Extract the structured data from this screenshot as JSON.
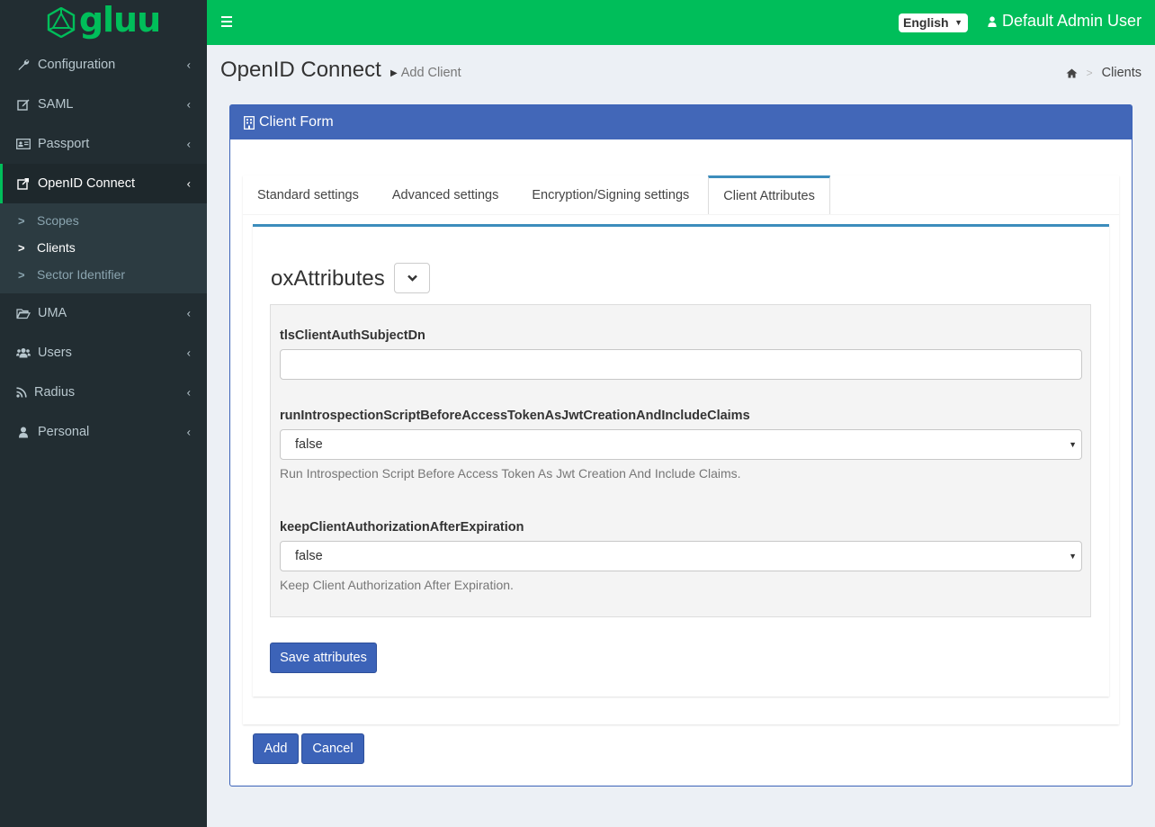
{
  "logo": {
    "text": "gluu"
  },
  "sidebar": {
    "items": [
      {
        "label": "Configuration",
        "icon": "wrench-icon"
      },
      {
        "label": "SAML",
        "icon": "edit-icon"
      },
      {
        "label": "Passport",
        "icon": "id-card-icon"
      },
      {
        "label": "OpenID Connect",
        "icon": "external-link-icon"
      },
      {
        "label": "UMA",
        "icon": "folder-open-icon"
      },
      {
        "label": "Users",
        "icon": "users-icon"
      },
      {
        "label": "Radius",
        "icon": "rss-icon"
      },
      {
        "label": "Personal",
        "icon": "user-icon"
      }
    ],
    "subitems": [
      {
        "label": "Scopes"
      },
      {
        "label": "Clients"
      },
      {
        "label": "Sector Identifier"
      }
    ]
  },
  "header": {
    "language": "English",
    "user": "Default Admin User"
  },
  "page": {
    "title": "OpenID Connect",
    "subtitle": "Add Client",
    "breadcrumb": "Clients"
  },
  "form": {
    "title": "Client Form",
    "tabs": [
      {
        "label": "Standard settings"
      },
      {
        "label": "Advanced settings"
      },
      {
        "label": "Encryption/Signing settings"
      },
      {
        "label": "Client Attributes"
      }
    ],
    "section_title": "oxAttributes",
    "fields": [
      {
        "label": "tlsClientAuthSubjectDn",
        "value": ""
      },
      {
        "label": "runIntrospectionScriptBeforeAccessTokenAsJwtCreationAndIncludeClaims",
        "value": "false",
        "help": "Run Introspection Script Before Access Token As Jwt Creation And Include Claims."
      },
      {
        "label": "keepClientAuthorizationAfterExpiration",
        "value": "false",
        "help": "Keep Client Authorization After Expiration."
      }
    ],
    "save_label": "Save attributes",
    "add_label": "Add",
    "cancel_label": "Cancel"
  },
  "colors": {
    "brand": "#00be5a",
    "sidebar": "#222d32",
    "primary": "#3c63b8"
  }
}
